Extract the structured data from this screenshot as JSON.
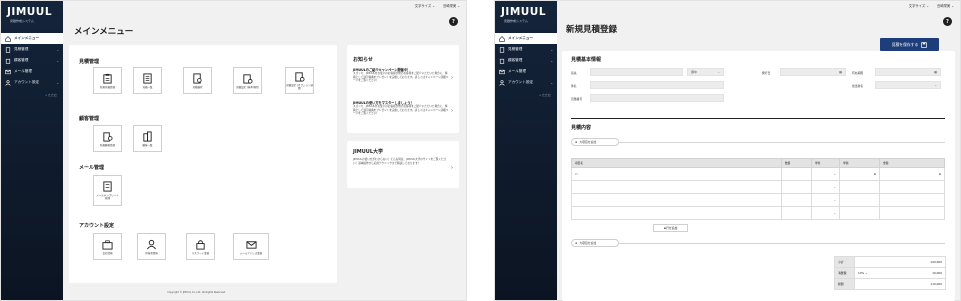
{
  "app": {
    "logo": "JIMUUL",
    "logo_sub": "見積作成システム",
    "font_size_label": "文字サイズ",
    "user_label": "島崎栄美",
    "help": "?",
    "collapse": "« たたむ"
  },
  "sidebar": {
    "items": [
      {
        "label": "メインメニュー",
        "icon": "home-icon"
      },
      {
        "label": "見積管理",
        "icon": "estimate-icon"
      },
      {
        "label": "顧客管理",
        "icon": "building-icon"
      },
      {
        "label": "メール管理",
        "icon": "mail-icon"
      },
      {
        "label": "アカウント設定",
        "icon": "person-icon"
      }
    ]
  },
  "main_menu": {
    "title": "メインメニュー",
    "sections": [
      {
        "title": "見積管理",
        "tiles": [
          "新規見積登録",
          "見積一覧",
          "見積検索",
          "見積設定\n(基本項目)",
          "見積設定\n(オプション項目)"
        ]
      },
      {
        "title": "顧客管理",
        "tiles": [
          "新規顧客登録",
          "顧客一覧"
        ]
      },
      {
        "title": "メール管理",
        "tiles": [
          "メールテンプレート\n管理"
        ]
      },
      {
        "title": "アカウント設定",
        "tiles": [
          "会社情報",
          "担当者情報",
          "パスワード変更",
          "メールアドレス変更"
        ]
      }
    ],
    "news": {
      "title": "お知らせ",
      "items": [
        {
          "head": "JIMUULのご紹介キャンペーン開催中！",
          "body": "スズッカ、JIMUULをお使いのお客様が他のお客様をご紹介いただいた場合に、特典として割引特典をプレゼントを実施しております。詳しくはキャンペーン詳細ページをご覧ください！"
        },
        {
          "head": "JIMUULの使い方をマスターしましょう！",
          "body": "スズッカ、JIMUULをお使いのお客様が他のお客様をご紹介いただいた場合に、特典として割引特典をプレゼントを実施しております。詳しくはキャンペーン詳細ページをご覧ください！"
        }
      ]
    },
    "univ": {
      "title": "JIMUUL大学",
      "body": "JIMUULの使い方がわからない？そんな時は、JIMUUL大学のサイトをご覧ください！基本操作から応用テクニックまで解説しております！"
    },
    "footer": "Copyright © JIMUUL Co.,Ltd. All Rights Reserved."
  },
  "form": {
    "title": "新規見積登録",
    "save_label": "見積を保存する",
    "basic_title": "見積基本情報",
    "fields": {
      "company": "宛先",
      "honorific": "御中",
      "subject": "件名",
      "estimate_no": "見積番号",
      "issue_date": "発行日",
      "valid_until": "有効期限",
      "person": "担当者名"
    },
    "items_title": "見積内容",
    "add_section": "大項目を追加",
    "columns": [
      "項目名",
      "数量",
      "単位",
      "単価",
      "金額"
    ],
    "add_row": "行を追加",
    "totals": [
      {
        "label": "小計",
        "value": "100,000"
      },
      {
        "label": "消費税",
        "rate": "10%",
        "value": "10,000"
      },
      {
        "label": "総額",
        "value": "110,000"
      }
    ]
  }
}
